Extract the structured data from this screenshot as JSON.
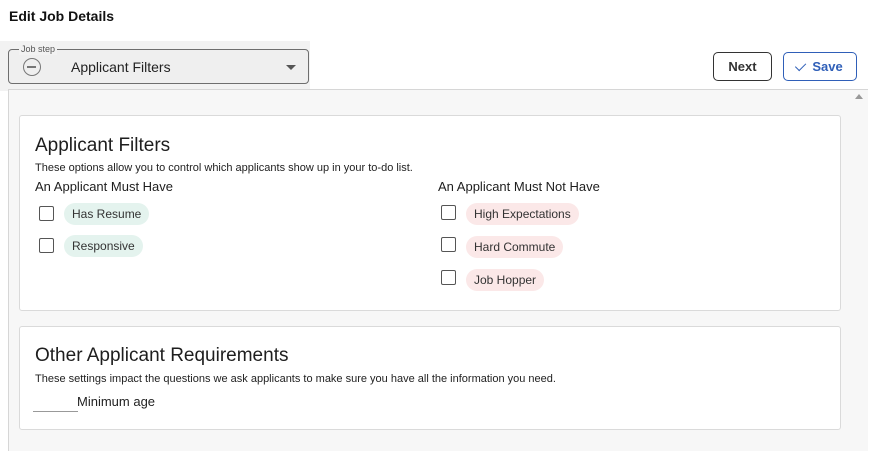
{
  "page": {
    "title": "Edit Job Details"
  },
  "job_step": {
    "legend": "Job step",
    "value": "Applicant Filters"
  },
  "actions": {
    "next_label": "Next",
    "save_label": "Save"
  },
  "filters_card": {
    "title": "Applicant Filters",
    "description": "These options allow you to control which applicants show up in your to-do list.",
    "must_have": {
      "heading": "An Applicant Must Have",
      "items": [
        {
          "label": "Has Resume",
          "checked": false
        },
        {
          "label": "Responsive",
          "checked": false
        }
      ]
    },
    "must_not_have": {
      "heading": "An Applicant Must Not Have",
      "items": [
        {
          "label": "High Expectations",
          "checked": false
        },
        {
          "label": "Hard Commute",
          "checked": false
        },
        {
          "label": "Job Hopper",
          "checked": false
        }
      ]
    }
  },
  "requirements_card": {
    "title": "Other Applicant Requirements",
    "description": "These settings impact the questions we ask applicants to make sure you have all the information you need.",
    "minimum_age": {
      "label": "Minimum age",
      "value": ""
    }
  },
  "colors": {
    "accent": "#2f5fb8",
    "tag_positive": "#e4f3ee",
    "tag_negative": "#fbe8e8"
  }
}
